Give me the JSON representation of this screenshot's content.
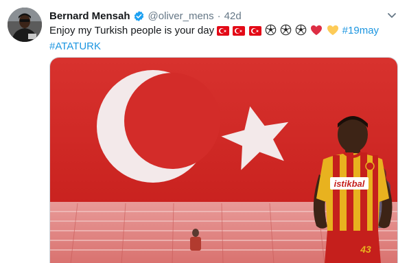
{
  "tweet": {
    "author_name": "Bernard Mensah",
    "handle": "@oliver_mens",
    "separator": "·",
    "time": "42d",
    "text_main": "Enjoy my Turkish people is your day",
    "hashtag_1": "#19may",
    "hashtag_2": "#ATATURK",
    "emojis": [
      "turkey-flag",
      "turkey-flag",
      "turkey-flag",
      "soccer-ball",
      "soccer-ball",
      "soccer-ball",
      "red-heart",
      "yellow-heart"
    ],
    "media": {
      "sponsor": "istikbal",
      "jersey_number": "43"
    }
  },
  "colors": {
    "link": "#1b95e0",
    "verified": "#1da1f2",
    "flag_red": "#e30a17",
    "secondary_text": "#657786"
  }
}
